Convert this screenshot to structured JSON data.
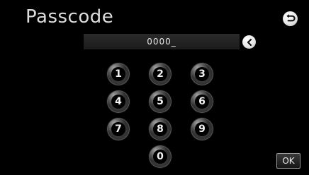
{
  "header": {
    "title": "Passcode"
  },
  "input": {
    "value": "0000_"
  },
  "keypad": {
    "keys": [
      "1",
      "2",
      "3",
      "4",
      "5",
      "6",
      "7",
      "8",
      "9",
      "0"
    ]
  },
  "actions": {
    "ok_label": "OK",
    "back_icon": "return-arrow-icon",
    "backspace_icon": "backspace-chevron-icon"
  }
}
